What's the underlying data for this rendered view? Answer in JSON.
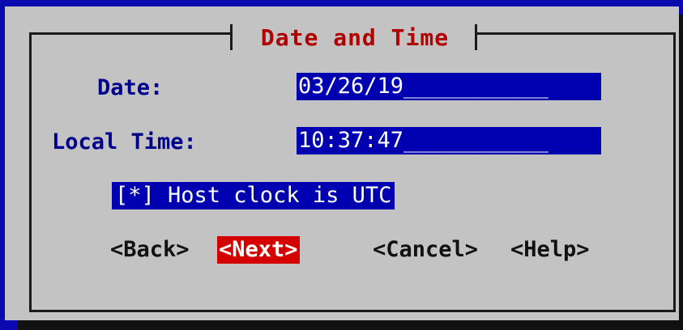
{
  "dialog": {
    "title": "Date and Time"
  },
  "form": {
    "date_label": "Date:",
    "date_value": "03/26/19",
    "date_fill": "___________",
    "time_label": "Local Time:",
    "time_value": "10:37:47",
    "time_fill": "___________",
    "utc_checkbox": "[*] Host clock is UTC"
  },
  "buttons": {
    "back": "<Back>",
    "next": "<Next>",
    "cancel": "<Cancel>",
    "help": "<Help>"
  },
  "colors": {
    "background": "#0000a8",
    "dialog": "#c3c3c3",
    "title": "#b00000",
    "label": "#00008b",
    "field": "#0000b0",
    "active_button": "#d40000"
  }
}
